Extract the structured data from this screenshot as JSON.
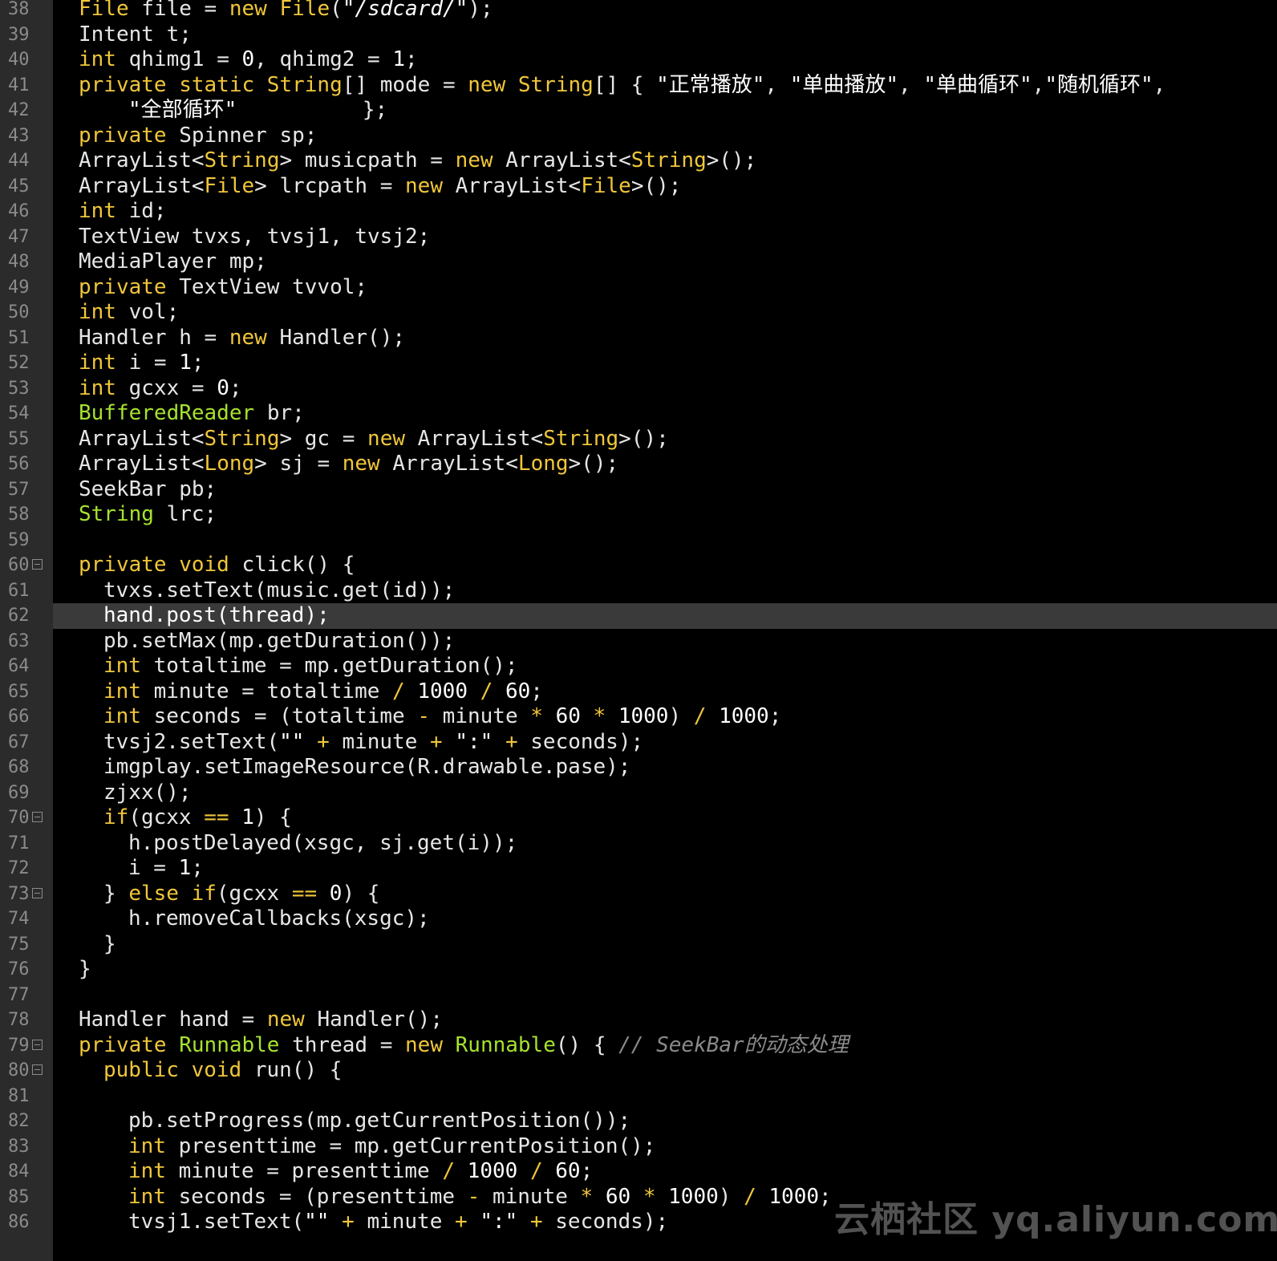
{
  "editor": {
    "theme": {
      "background": "#000000",
      "gutter": "#2b2b2b",
      "current_line": "#3a3a3a",
      "keyword": "#f0c63a",
      "type": "#a6e22e",
      "plain": "#e6e6e6",
      "comment": "#8a8a8a"
    },
    "current_line_number": "62",
    "lines": [
      {
        "num": "38",
        "indent": 0,
        "fold": false,
        "tokens": [
          [
            "kw",
            "File"
          ],
          [
            "",
            "file = "
          ],
          [
            "kw",
            "new"
          ],
          [
            "",
            ""
          ],
          [
            "kw",
            "File"
          ],
          [
            "",
            "("
          ],
          [
            "strI",
            "\"/sdcard/\""
          ],
          [
            "",
            ");"
          ]
        ]
      },
      {
        "num": "39",
        "indent": 0,
        "fold": false,
        "tokens": [
          [
            "",
            "Intent t;"
          ]
        ]
      },
      {
        "num": "40",
        "indent": 0,
        "fold": false,
        "tokens": [
          [
            "kw",
            "int"
          ],
          [
            "",
            "qhimg1 = "
          ],
          [
            "wht",
            "0"
          ],
          [
            "",
            ", qhimg2 = "
          ],
          [
            "wht",
            "1"
          ],
          [
            "",
            ";"
          ]
        ]
      },
      {
        "num": "41",
        "indent": 0,
        "fold": false,
        "tokens": [
          [
            "kw",
            "private static String"
          ],
          [
            "",
            "[] mode = "
          ],
          [
            "kw",
            "new String"
          ],
          [
            "",
            "[] { "
          ],
          [
            "str",
            "\"正常播放\""
          ],
          [
            "",
            ", "
          ],
          [
            "str",
            "\"单曲播放\""
          ],
          [
            "",
            ", "
          ],
          [
            "str",
            "\"单曲循环\""
          ],
          [
            "",
            ","
          ],
          [
            "str",
            "\"随机循环\""
          ],
          [
            "",
            ","
          ]
        ]
      },
      {
        "num": "42",
        "indent": 2,
        "fold": false,
        "tokens": [
          [
            "str",
            "\"全部循环\""
          ],
          [
            "",
            ""
          ],
          [
            "",
            ""
          ],
          [
            "",
            ""
          ],
          [
            "",
            ""
          ],
          [
            "",
            ""
          ],
          [
            "",
            ""
          ],
          [
            "",
            ""
          ],
          [
            "",
            ""
          ],
          [
            "",
            ""
          ],
          [
            "",
            ""
          ],
          [
            "",
            "};"
          ]
        ]
      },
      {
        "num": "43",
        "indent": 0,
        "fold": false,
        "tokens": [
          [
            "kw",
            "private"
          ],
          [
            "",
            "Spinner sp;"
          ]
        ]
      },
      {
        "num": "44",
        "indent": 0,
        "fold": false,
        "tokens": [
          [
            "",
            "ArrayList<"
          ],
          [
            "kw",
            "String"
          ],
          [
            "",
            "> musicpath = "
          ],
          [
            "kw",
            "new"
          ],
          [
            "",
            "ArrayList<"
          ],
          [
            "kw",
            "String"
          ],
          [
            "",
            ">();"
          ]
        ]
      },
      {
        "num": "45",
        "indent": 0,
        "fold": false,
        "tokens": [
          [
            "",
            "ArrayList<"
          ],
          [
            "kw",
            "File"
          ],
          [
            "",
            "> lrcpath = "
          ],
          [
            "kw",
            "new"
          ],
          [
            "",
            "ArrayList<"
          ],
          [
            "kw",
            "File"
          ],
          [
            "",
            ">();"
          ]
        ]
      },
      {
        "num": "46",
        "indent": 0,
        "fold": false,
        "tokens": [
          [
            "kw",
            "int"
          ],
          [
            "",
            "id;"
          ]
        ]
      },
      {
        "num": "47",
        "indent": 0,
        "fold": false,
        "tokens": [
          [
            "",
            "TextView tvxs, tvsj1, tvsj2;"
          ]
        ]
      },
      {
        "num": "48",
        "indent": 0,
        "fold": false,
        "tokens": [
          [
            "",
            "MediaPlayer mp;"
          ]
        ]
      },
      {
        "num": "49",
        "indent": 0,
        "fold": false,
        "tokens": [
          [
            "kw",
            "private"
          ],
          [
            "",
            "TextView tvvol;"
          ]
        ]
      },
      {
        "num": "50",
        "indent": 0,
        "fold": false,
        "tokens": [
          [
            "kw",
            "int"
          ],
          [
            "",
            "vol;"
          ]
        ]
      },
      {
        "num": "51",
        "indent": 0,
        "fold": false,
        "tokens": [
          [
            "",
            "Handler h = "
          ],
          [
            "kw",
            "new"
          ],
          [
            "",
            "Handler();"
          ]
        ]
      },
      {
        "num": "52",
        "indent": 0,
        "fold": false,
        "tokens": [
          [
            "kw",
            "int"
          ],
          [
            "",
            "i = "
          ],
          [
            "wht",
            "1"
          ],
          [
            "",
            ";"
          ]
        ]
      },
      {
        "num": "53",
        "indent": 0,
        "fold": false,
        "tokens": [
          [
            "kw",
            "int"
          ],
          [
            "",
            "gcxx = "
          ],
          [
            "wht",
            "0"
          ],
          [
            "",
            ";"
          ]
        ]
      },
      {
        "num": "54",
        "indent": 0,
        "fold": false,
        "tokens": [
          [
            "ty",
            "BufferedReader"
          ],
          [
            "",
            "br;"
          ]
        ]
      },
      {
        "num": "55",
        "indent": 0,
        "fold": false,
        "tokens": [
          [
            "",
            "ArrayList<"
          ],
          [
            "kw",
            "String"
          ],
          [
            "",
            "> gc = "
          ],
          [
            "kw",
            "new"
          ],
          [
            "",
            "ArrayList<"
          ],
          [
            "kw",
            "String"
          ],
          [
            "",
            ">();"
          ]
        ]
      },
      {
        "num": "56",
        "indent": 0,
        "fold": false,
        "tokens": [
          [
            "",
            "ArrayList<"
          ],
          [
            "kw",
            "Long"
          ],
          [
            "",
            "> sj = "
          ],
          [
            "kw",
            "new"
          ],
          [
            "",
            "ArrayList<"
          ],
          [
            "kw",
            "Long"
          ],
          [
            "",
            ">();"
          ]
        ]
      },
      {
        "num": "57",
        "indent": 0,
        "fold": false,
        "tokens": [
          [
            "",
            "SeekBar pb;"
          ]
        ]
      },
      {
        "num": "58",
        "indent": 0,
        "fold": false,
        "tokens": [
          [
            "ty",
            "String"
          ],
          [
            "",
            "lrc;"
          ]
        ]
      },
      {
        "num": "59",
        "indent": 0,
        "fold": false,
        "tokens": []
      },
      {
        "num": "60",
        "indent": 0,
        "fold": true,
        "tokens": [
          [
            "kw",
            "private void"
          ],
          [
            "",
            "click() {"
          ]
        ]
      },
      {
        "num": "61",
        "indent": 1,
        "fold": false,
        "tokens": [
          [
            "",
            "tvxs.setText(music.get(id));"
          ]
        ]
      },
      {
        "num": "62",
        "indent": 1,
        "fold": false,
        "tokens": [
          [
            "wht",
            "hand.post(thread);"
          ]
        ]
      },
      {
        "num": "63",
        "indent": 1,
        "fold": false,
        "tokens": [
          [
            "",
            "pb.setMax(mp.getDuration());"
          ]
        ]
      },
      {
        "num": "64",
        "indent": 1,
        "fold": false,
        "tokens": [
          [
            "kw",
            "int"
          ],
          [
            "",
            "totaltime = mp.getDuration();"
          ]
        ]
      },
      {
        "num": "65",
        "indent": 1,
        "fold": false,
        "tokens": [
          [
            "kw",
            "int"
          ],
          [
            "",
            "minute = totaltime "
          ],
          [
            "kw",
            "/"
          ],
          [
            "",
            ""
          ],
          [
            "wht",
            "1000"
          ],
          [
            "",
            ""
          ],
          [
            "kw",
            "/"
          ],
          [
            "",
            ""
          ],
          [
            "wht",
            "60"
          ],
          [
            "",
            ";"
          ]
        ]
      },
      {
        "num": "66",
        "indent": 1,
        "fold": false,
        "tokens": [
          [
            "kw",
            "int"
          ],
          [
            "",
            "seconds = (totaltime "
          ],
          [
            "kw",
            "-"
          ],
          [
            "",
            "minute "
          ],
          [
            "kw",
            "*"
          ],
          [
            "",
            ""
          ],
          [
            "wht",
            "60"
          ],
          [
            "",
            ""
          ],
          [
            "kw",
            "*"
          ],
          [
            "",
            ""
          ],
          [
            "wht",
            "1000"
          ],
          [
            "",
            ") "
          ],
          [
            "kw",
            "/"
          ],
          [
            "",
            ""
          ],
          [
            "wht",
            "1000"
          ],
          [
            "",
            ";"
          ]
        ]
      },
      {
        "num": "67",
        "indent": 1,
        "fold": false,
        "tokens": [
          [
            "",
            "tvsj2.setText("
          ],
          [
            "str",
            "\"\""
          ],
          [
            "",
            ""
          ],
          [
            "kw",
            "+"
          ],
          [
            "",
            "minute "
          ],
          [
            "kw",
            "+"
          ],
          [
            "",
            ""
          ],
          [
            "str",
            "\":\""
          ],
          [
            "",
            ""
          ],
          [
            "kw",
            "+"
          ],
          [
            "",
            "seconds);"
          ]
        ]
      },
      {
        "num": "68",
        "indent": 1,
        "fold": false,
        "tokens": [
          [
            "",
            "imgplay.setImageResource(R.drawable.pase);"
          ]
        ]
      },
      {
        "num": "69",
        "indent": 1,
        "fold": false,
        "tokens": [
          [
            "",
            "zjxx();"
          ]
        ]
      },
      {
        "num": "70",
        "indent": 1,
        "fold": true,
        "tokens": [
          [
            "kw",
            "if"
          ],
          [
            "",
            "(gcxx "
          ],
          [
            "kw",
            "=="
          ],
          [
            "",
            ""
          ],
          [
            "wht",
            "1"
          ],
          [
            "",
            ") {"
          ]
        ]
      },
      {
        "num": "71",
        "indent": 2,
        "fold": false,
        "tokens": [
          [
            "",
            "h.postDelayed(xsgc, sj.get(i));"
          ]
        ]
      },
      {
        "num": "72",
        "indent": 2,
        "fold": false,
        "tokens": [
          [
            "",
            "i = "
          ],
          [
            "wht",
            "1"
          ],
          [
            "",
            ";"
          ]
        ]
      },
      {
        "num": "73",
        "indent": 1,
        "fold": true,
        "tokens": [
          [
            "",
            "} "
          ],
          [
            "kw",
            "else if"
          ],
          [
            "",
            "(gcxx "
          ],
          [
            "kw",
            "=="
          ],
          [
            "",
            ""
          ],
          [
            "wht",
            "0"
          ],
          [
            "",
            ") {"
          ]
        ]
      },
      {
        "num": "74",
        "indent": 2,
        "fold": false,
        "tokens": [
          [
            "",
            "h.removeCallbacks(xsgc);"
          ]
        ]
      },
      {
        "num": "75",
        "indent": 1,
        "fold": false,
        "tokens": [
          [
            "",
            "}"
          ]
        ]
      },
      {
        "num": "76",
        "indent": 0,
        "fold": false,
        "tokens": [
          [
            "",
            "}"
          ]
        ]
      },
      {
        "num": "77",
        "indent": 0,
        "fold": false,
        "tokens": []
      },
      {
        "num": "78",
        "indent": 0,
        "fold": false,
        "tokens": [
          [
            "",
            "Handler hand = "
          ],
          [
            "kw",
            "new"
          ],
          [
            "",
            "Handler();"
          ]
        ]
      },
      {
        "num": "79",
        "indent": 0,
        "fold": true,
        "tokens": [
          [
            "kw",
            "private"
          ],
          [
            "",
            ""
          ],
          [
            "ty",
            "Runnable"
          ],
          [
            "",
            "thread = "
          ],
          [
            "kw",
            "new"
          ],
          [
            "",
            ""
          ],
          [
            "ty",
            "Runnable"
          ],
          [
            "",
            "() { "
          ],
          [
            "cm",
            "// SeekBar的动态处理"
          ]
        ]
      },
      {
        "num": "80",
        "indent": 1,
        "fold": true,
        "tokens": [
          [
            "kw",
            "public void"
          ],
          [
            "",
            "run() {"
          ]
        ]
      },
      {
        "num": "81",
        "indent": 0,
        "fold": false,
        "tokens": []
      },
      {
        "num": "82",
        "indent": 2,
        "fold": false,
        "tokens": [
          [
            "",
            "pb.setProgress(mp.getCurrentPosition());"
          ]
        ]
      },
      {
        "num": "83",
        "indent": 2,
        "fold": false,
        "tokens": [
          [
            "kw",
            "int"
          ],
          [
            "",
            "presenttime = mp.getCurrentPosition();"
          ]
        ]
      },
      {
        "num": "84",
        "indent": 2,
        "fold": false,
        "tokens": [
          [
            "kw",
            "int"
          ],
          [
            "",
            "minute = presenttime "
          ],
          [
            "kw",
            "/"
          ],
          [
            "",
            ""
          ],
          [
            "wht",
            "1000"
          ],
          [
            "",
            ""
          ],
          [
            "kw",
            "/"
          ],
          [
            "",
            ""
          ],
          [
            "wht",
            "60"
          ],
          [
            "",
            ";"
          ]
        ]
      },
      {
        "num": "85",
        "indent": 2,
        "fold": false,
        "tokens": [
          [
            "kw",
            "int"
          ],
          [
            "",
            "seconds = (presenttime "
          ],
          [
            "kw",
            "-"
          ],
          [
            "",
            "minute "
          ],
          [
            "kw",
            "*"
          ],
          [
            "",
            ""
          ],
          [
            "wht",
            "60"
          ],
          [
            "",
            ""
          ],
          [
            "kw",
            "*"
          ],
          [
            "",
            ""
          ],
          [
            "wht",
            "1000"
          ],
          [
            "",
            ") "
          ],
          [
            "kw",
            "/"
          ],
          [
            "",
            ""
          ],
          [
            "wht",
            "1000"
          ],
          [
            "",
            ";"
          ]
        ]
      },
      {
        "num": "86",
        "indent": 2,
        "fold": false,
        "tokens": [
          [
            "",
            "tvsj1.setText("
          ],
          [
            "str",
            "\"\""
          ],
          [
            "",
            ""
          ],
          [
            "kw",
            "+"
          ],
          [
            "",
            "minute "
          ],
          [
            "kw",
            "+"
          ],
          [
            "",
            ""
          ],
          [
            "str",
            "\":\""
          ],
          [
            "",
            ""
          ],
          [
            "kw",
            "+"
          ],
          [
            "",
            "seconds);"
          ]
        ]
      }
    ]
  },
  "watermark": {
    "text": "云栖社区 yq.aliyun.com"
  }
}
